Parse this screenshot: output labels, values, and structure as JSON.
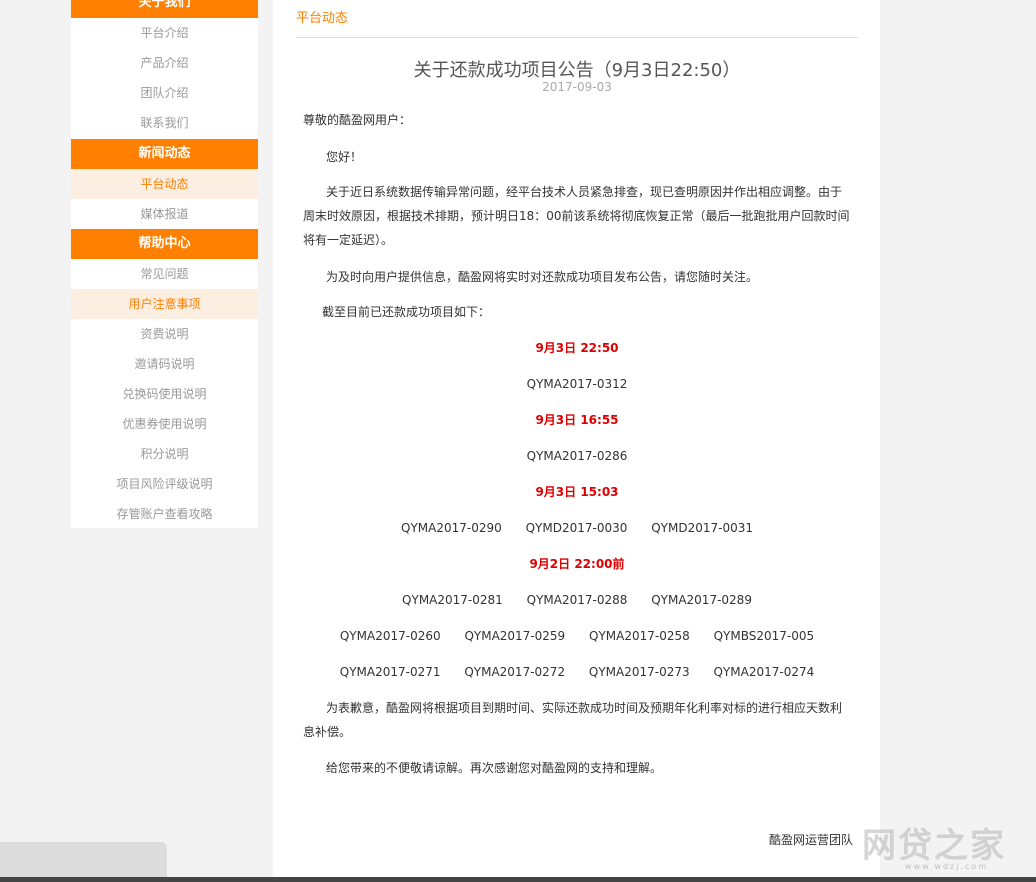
{
  "sidebar": {
    "section_about": "关于我们",
    "about_items": [
      "平台介绍",
      "产品介绍",
      "团队介绍",
      "联系我们"
    ],
    "section_news": "新闻动态",
    "news_items": [
      "平台动态",
      "媒体报道"
    ],
    "section_help": "帮助中心",
    "help_items": [
      "常见问题",
      "用户注意事项",
      "资费说明",
      "邀请码说明",
      "兑换码使用说明",
      "优惠券使用说明",
      "积分说明",
      "项目风险评级说明",
      "存管账户查看攻略"
    ]
  },
  "breadcrumb": "平台动态",
  "article": {
    "title": "关于还款成功项目公告（9月3日22:50）",
    "date": "2017-09-03",
    "greeting": "尊敬的酷盈网用户：",
    "hello": "您好！",
    "para1a": "关于近日系统数据传输异常问题，经平台技术人员紧急排查，现已查明原因并作出相应调整。由于",
    "para1b": "周末时效原因，根据技术排期，预计明日18：00前该系统将彻底恢复正常（最后一批跑批用户回款时间",
    "para1c": "将有一定延迟）。",
    "para2": "为及时向用户提供信息，酷盈网将实时对还款成功项目发布公告，请您随时关注。",
    "para3": "截至目前已还款成功项目如下：",
    "groups": [
      {
        "time": "9月3日  22:50",
        "rows": [
          [
            "QYMA2017-0312"
          ]
        ]
      },
      {
        "time": "9月3日  16:55",
        "rows": [
          [
            "QYMA2017-0286"
          ]
        ]
      },
      {
        "time": "9月3日  15:03",
        "rows": [
          [
            "QYMA2017-0290",
            "QYMD2017-0030",
            "QYMD2017-0031"
          ]
        ]
      },
      {
        "time": "9月2日  22:00前",
        "rows": [
          [
            "QYMA2017-0281",
            "QYMA2017-0288",
            "QYMA2017-0289"
          ],
          [
            "QYMA2017-0260",
            "QYMA2017-0259",
            "QYMA2017-0258",
            "QYMBS2017-005"
          ],
          [
            "QYMA2017-0271",
            "QYMA2017-0272",
            "QYMA2017-0273",
            "QYMA2017-0274"
          ]
        ]
      }
    ],
    "para4a": "为表歉意，酷盈网将根据项目到期时间、实际还款成功时间及预期年化利率对标的进行相应天数利",
    "para4b": "息补偿。",
    "para5": "给您带来的不便敬请谅解。再次感谢您对酷盈网的支持和理解。",
    "signature": "酷盈网运营团队"
  },
  "watermark": {
    "main": "网贷之家",
    "sub": "www.wdzj.com"
  }
}
